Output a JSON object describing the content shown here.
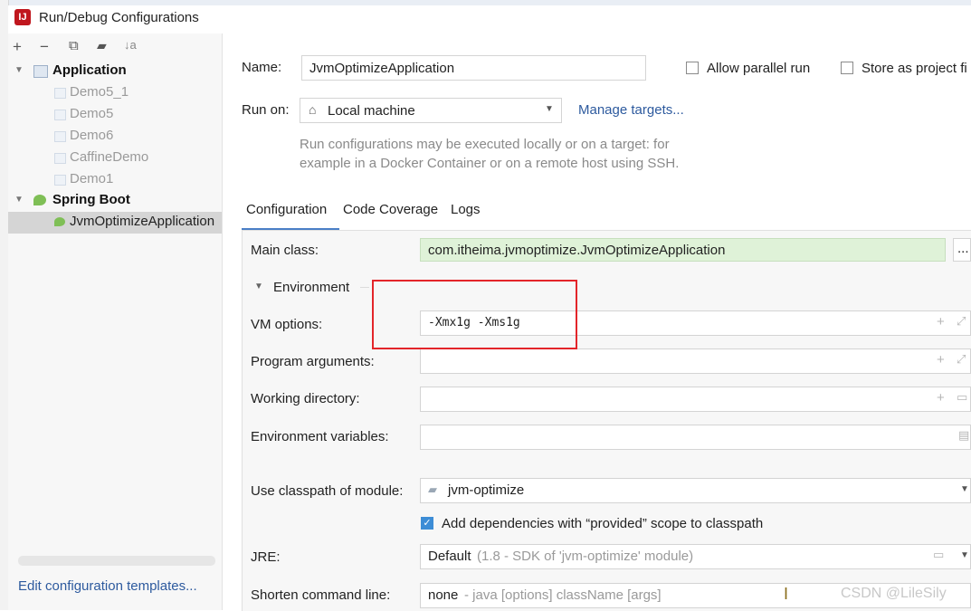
{
  "window": {
    "title": "Run/Debug Configurations",
    "logo": "IJ"
  },
  "toolbar_icons": [
    "add-icon",
    "remove-icon",
    "copy-icon",
    "move-to-folder-icon",
    "sort-icon"
  ],
  "toolbar_glyphs": {
    "add": "+",
    "remove": "−",
    "copy": "⧉",
    "folder": "▰",
    "sort": "↓a"
  },
  "tree": {
    "application": {
      "label": "Application",
      "children": [
        "Demo5_1",
        "Demo5",
        "Demo6",
        "CaffineDemo",
        "Demo1"
      ]
    },
    "spring_boot": {
      "label": "Spring Boot",
      "children": [
        "JvmOptimizeApplication"
      ]
    },
    "selected": "JvmOptimizeApplication"
  },
  "footer_link": "Edit configuration templates...",
  "form": {
    "name_label": "Name:",
    "name_value": "JvmOptimizeApplication",
    "allow_parallel_label": "Allow parallel run",
    "store_as_project_label": "Store as project fi",
    "run_on_label": "Run on:",
    "run_on_value": "Local machine",
    "manage_targets": "Manage targets...",
    "run_on_hint_1": "Run configurations may be executed locally or on a target: for",
    "run_on_hint_2": "example in a Docker Container or on a remote host using SSH."
  },
  "tabs": [
    "Configuration",
    "Code Coverage",
    "Logs"
  ],
  "config": {
    "main_class_label": "Main class:",
    "main_class_value": "com.itheima.jvmoptimize.JvmOptimizeApplication",
    "browse_label": "...",
    "environment_label": "Environment",
    "vm_options_label": "VM options:",
    "vm_options_value": "-Xmx1g -Xms1g",
    "program_args_label": "Program arguments:",
    "working_dir_label": "Working directory:",
    "env_vars_label": "Environment variables:",
    "classpath_label": "Use classpath of module:",
    "classpath_value": "jvm-optimize",
    "add_deps_label": "Add dependencies with “provided” scope to classpath",
    "add_deps_checked": true,
    "jre_label": "JRE:",
    "jre_value": "Default",
    "jre_detail": "(1.8 - SDK of 'jvm-optimize' module)",
    "shorten_label": "Shorten command line:",
    "shorten_value": "none",
    "shorten_detail": "- java [options] className [args]"
  },
  "watermark": "CSDN @LileSily",
  "colors": {
    "accent": "#3d8dd6",
    "link": "#2d5a9e",
    "highlight_field": "#dff2d8",
    "annotation_box": "#e3252a"
  }
}
